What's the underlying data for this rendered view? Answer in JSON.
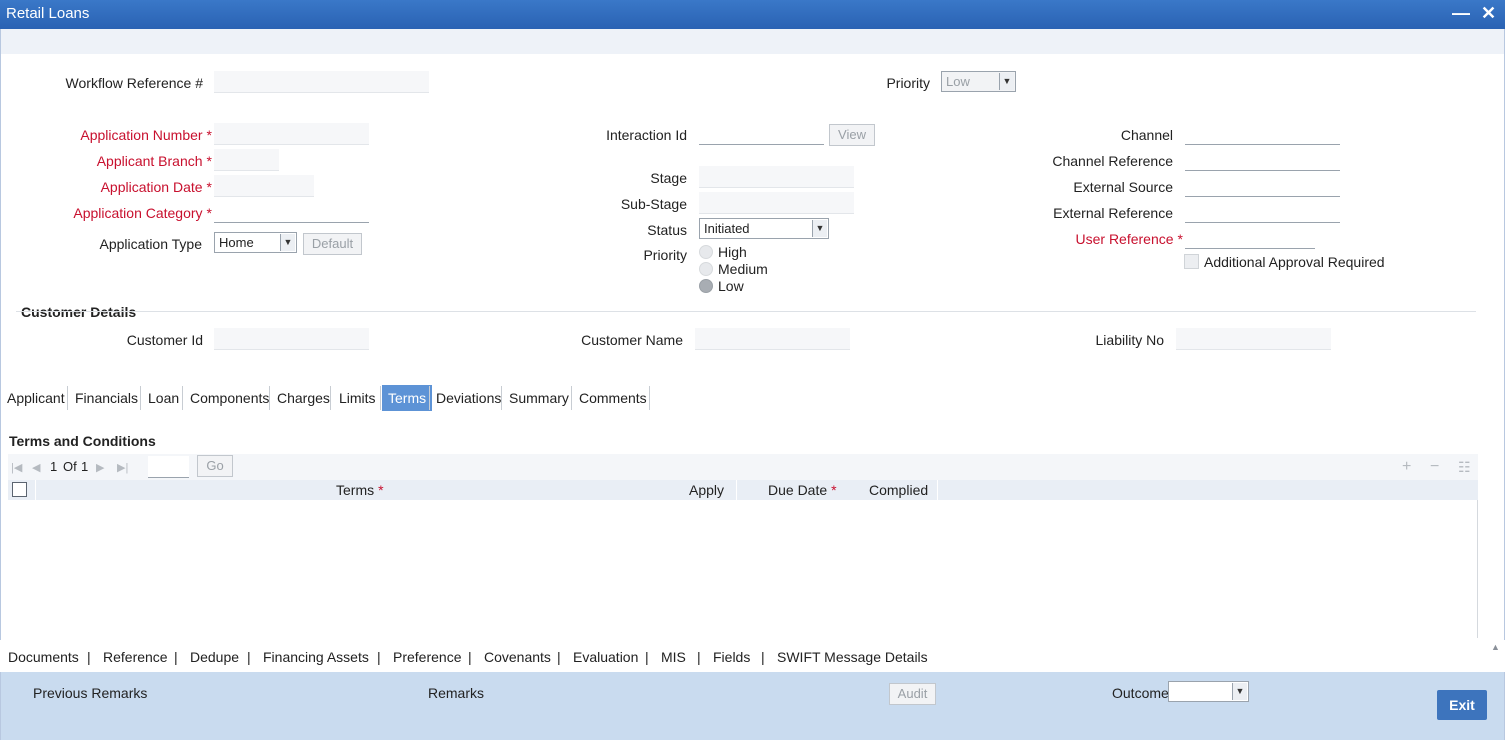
{
  "window": {
    "title": "Retail Loans",
    "minimize": "—",
    "close": "✕"
  },
  "header": {
    "workflow_ref_label": "Workflow Reference #",
    "priority_label": "Priority",
    "priority_value": "Low"
  },
  "left": {
    "application_number": "Application Number",
    "applicant_branch": "Applicant Branch",
    "application_date": "Application Date",
    "application_category": "Application Category",
    "application_type": "Application Type",
    "application_type_value": "Home",
    "default_button": "Default",
    "required_mark": "*"
  },
  "middle": {
    "interaction_id": "Interaction Id",
    "view_button": "View",
    "stage": "Stage",
    "sub_stage": "Sub-Stage",
    "status": "Status",
    "status_value": "Initiated",
    "priority": "Priority",
    "priority_options": [
      "High",
      "Medium",
      "Low"
    ],
    "priority_selected": "Low"
  },
  "right": {
    "channel": "Channel",
    "channel_reference": "Channel Reference",
    "external_source": "External Source",
    "external_reference": "External Reference",
    "user_reference": "User Reference",
    "additional_approval": "Additional Approval Required"
  },
  "customer": {
    "section_title": "Customer Details",
    "customer_id": "Customer Id",
    "customer_name": "Customer Name",
    "liability_no": "Liability No"
  },
  "tabs": [
    "Applicant",
    "Financials",
    "Loan",
    "Components",
    "Charges",
    "Limits",
    "Terms",
    "Deviations",
    "Summary",
    "Comments"
  ],
  "active_tab": "Terms",
  "terms": {
    "section_title": "Terms and Conditions",
    "page_current": "1",
    "page_of": "Of",
    "page_total": "1",
    "go_button": "Go",
    "columns": [
      "Terms",
      "Apply",
      "Due Date",
      "Complied"
    ]
  },
  "bottom_nav": [
    "Documents",
    "Reference",
    "Dedupe",
    "Financing Assets",
    "Preference",
    "Covenants",
    "Evaluation",
    "MIS",
    "Fields",
    "SWIFT Message Details"
  ],
  "footer": {
    "previous_remarks": "Previous Remarks",
    "remarks": "Remarks",
    "audit_button": "Audit",
    "outcome": "Outcome",
    "exit_button": "Exit"
  }
}
